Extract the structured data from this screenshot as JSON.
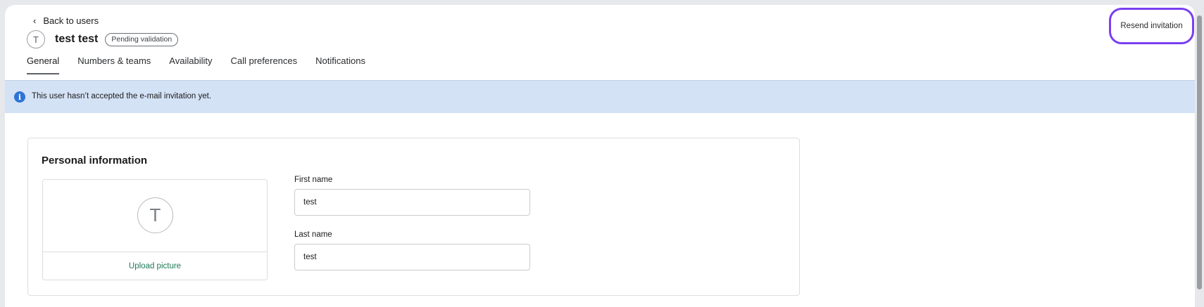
{
  "nav": {
    "back_label": "Back to users",
    "back_icon": "chevron-left-icon"
  },
  "user": {
    "initial": "T",
    "name": "test test",
    "status_badge": "Pending validation"
  },
  "tabs": [
    {
      "label": "General",
      "active": true
    },
    {
      "label": "Numbers & teams",
      "active": false
    },
    {
      "label": "Availability",
      "active": false
    },
    {
      "label": "Call preferences",
      "active": false
    },
    {
      "label": "Notifications",
      "active": false
    }
  ],
  "banner": {
    "icon": "info-icon",
    "message": "This user hasn’t accepted the e-mail invitation yet.",
    "action_label": "Resend invitation",
    "background": "#d4e2f6",
    "highlight_color": "#7a3ff0"
  },
  "personal_info": {
    "title": "Personal information",
    "avatar_initial": "T",
    "upload_label": "Upload picture",
    "first_name_label": "First name",
    "first_name_value": "test",
    "last_name_label": "Last name",
    "last_name_value": "test"
  }
}
